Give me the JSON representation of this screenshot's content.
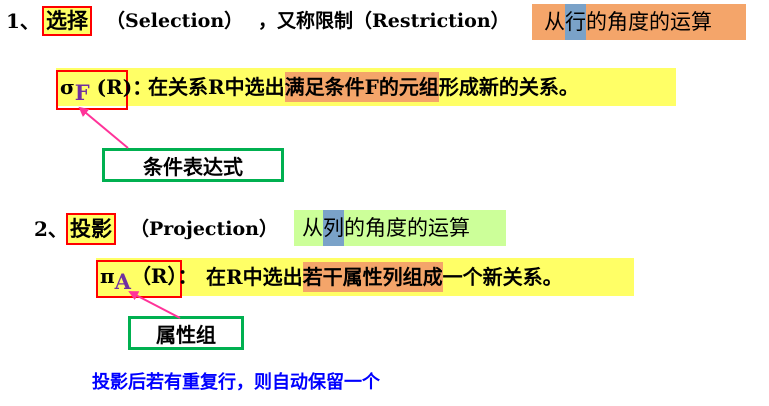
{
  "selection": {
    "number": "1、",
    "term": "选择",
    "english": "（Selection）",
    "alias": "，又称限制（Restriction）",
    "perspective_pre": "从",
    "perspective_key": "行",
    "perspective_post": "的角度的运算",
    "formula": {
      "symbol": "σ",
      "subscript": "F",
      "arg": " (R)",
      "colon": "："
    },
    "desc_pre": "在关系R中选出",
    "desc_highlight": "满足条件F的元组",
    "desc_post": "形成新的关系。",
    "annotation": "条件表达式"
  },
  "projection": {
    "number": "2、",
    "term": "投影",
    "english": "（Projection）",
    "perspective_pre": "从",
    "perspective_key": "列",
    "perspective_post": "的角度的运算",
    "formula": {
      "symbol": "π",
      "subscript": "A",
      "arg": "（R）",
      "colon": "："
    },
    "desc_pre": "在R中选出",
    "desc_highlight": "若干属性列组成",
    "desc_post": "一个新关系。",
    "annotation": "属性组",
    "note": "投影后若有重复行，则自动保留一个"
  },
  "colors": {
    "highlight_yellow": "#ffff66",
    "highlight_orange": "#f4a56a",
    "highlight_green": "#ccff99",
    "highlight_blue": "#7aa2c8",
    "box_red": "#ff0000",
    "box_green": "#00b050",
    "arrow": "#ff3399",
    "subscript_purple": "#7030a0",
    "note_blue": "#0000ff"
  }
}
